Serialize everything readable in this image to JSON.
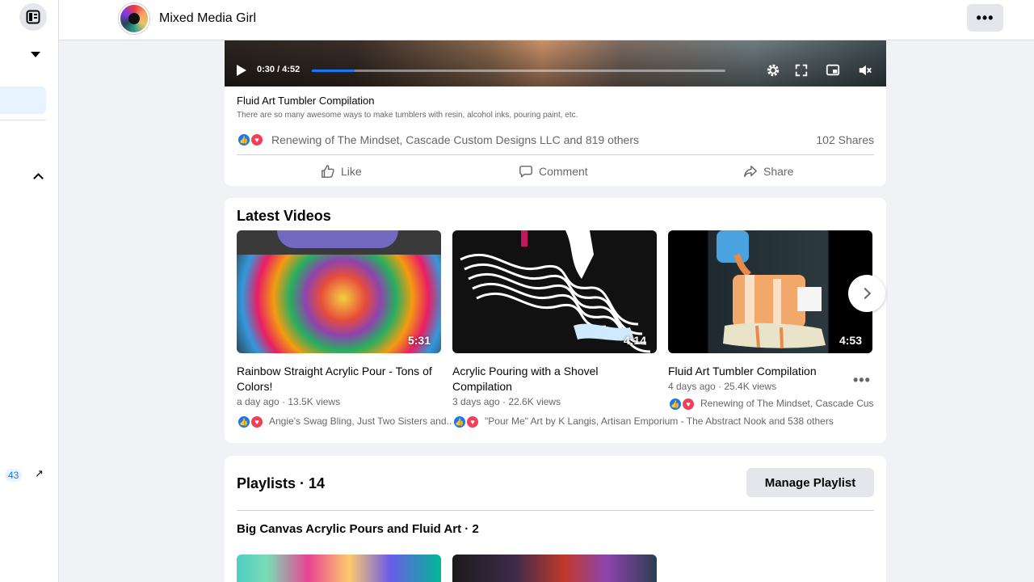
{
  "header": {
    "page_name": "Mixed Media Girl",
    "more_label": "•••"
  },
  "rail": {
    "badge": "43",
    "arrow": "↗"
  },
  "post": {
    "time_display": "0:30 / 4:52",
    "progress_fraction": 0.104,
    "title": "Fluid Art Tumbler Compilation",
    "description": "There are so many awesome ways to make tumblers with resin, alcohol inks, pouring paint, etc.",
    "reactions_text": "Renewing of The Mindset, Cascade Custom Designs LLC and 819 others",
    "shares_text": "102 Shares",
    "actions": [
      {
        "label": "Like",
        "icon": "like-icon"
      },
      {
        "label": "Comment",
        "icon": "comment-icon"
      },
      {
        "label": "Share",
        "icon": "share-icon"
      }
    ]
  },
  "latest_videos": {
    "title": "Latest Videos",
    "videos": [
      {
        "duration": "5:31",
        "title": "Rainbow Straight Acrylic Pour - Tons of Colors!",
        "meta": "a day ago · 13.5K views",
        "reactions": "Angie's Swag Bling, Just Two Sisters and..."
      },
      {
        "duration": "4:14",
        "title": "Acrylic Pouring with a Shovel Compilation",
        "meta": "3 days ago · 22.6K views",
        "reactions": "\"Pour Me\" Art by K Langis, Artisan Emporium - The Abstract Nook and 538 others"
      },
      {
        "duration": "4:53",
        "title": "Fluid Art Tumbler Compilation",
        "meta": "4 days ago · 25.4K views",
        "reactions": "Renewing of The Mindset, Cascade Cus"
      }
    ],
    "more_label": "•••"
  },
  "playlists": {
    "title": "Playlists · 14",
    "manage_label": "Manage Playlist",
    "playlist_name": "Big Canvas Acrylic Pours and Fluid Art · 2"
  },
  "colors": {
    "accent": "#1877f2",
    "love": "#f33e58",
    "secondary_text": "#65676b"
  }
}
